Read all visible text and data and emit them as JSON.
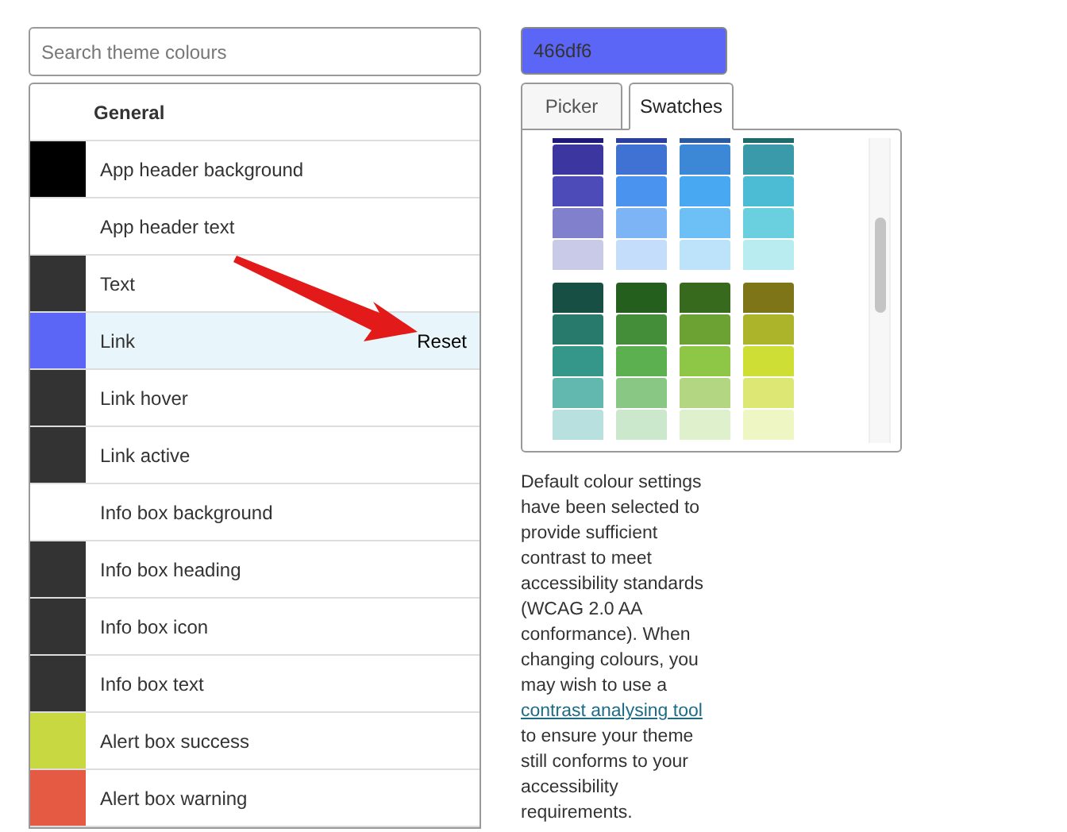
{
  "search": {
    "placeholder": "Search theme colours"
  },
  "colour_list": {
    "heading": "General",
    "items": [
      {
        "name": "App header background",
        "color": "#000000",
        "selected": false
      },
      {
        "name": "App header text",
        "color": "#ffffff",
        "selected": false
      },
      {
        "name": "Text",
        "color": "#333333",
        "selected": false
      },
      {
        "name": "Link",
        "color": "#5b66f6",
        "selected": true,
        "action": "Reset"
      },
      {
        "name": "Link hover",
        "color": "#333333",
        "selected": false
      },
      {
        "name": "Link active",
        "color": "#333333",
        "selected": false
      },
      {
        "name": "Info box background",
        "color": "#ffffff",
        "selected": false
      },
      {
        "name": "Info box heading",
        "color": "#333333",
        "selected": false
      },
      {
        "name": "Info box icon",
        "color": "#333333",
        "selected": false
      },
      {
        "name": "Info box text",
        "color": "#333333",
        "selected": false
      },
      {
        "name": "Alert box success",
        "color": "#c8d840",
        "selected": false
      },
      {
        "name": "Alert box warning",
        "color": "#e45a42",
        "selected": false
      }
    ]
  },
  "colour_field": {
    "value": "466df6",
    "color": "#5b66f6"
  },
  "tabs": [
    {
      "label": "Picker",
      "selected": false
    },
    {
      "label": "Swatches",
      "selected": true
    }
  ],
  "swatch_groups": [
    {
      "rows": [
        {
          "cut": true,
          "swatches": [
            {
              "color": "#1e1a78"
            },
            {
              "color": "#2a3f9e"
            },
            {
              "color": "#2c5aa0"
            },
            {
              "color": "#1f6a6a"
            }
          ]
        },
        {
          "cut": false,
          "swatches": [
            {
              "color": "#3c37a0"
            },
            {
              "color": "#3f72d2"
            },
            {
              "color": "#3c88d6"
            },
            {
              "color": "#3a9aaa"
            }
          ]
        },
        {
          "cut": false,
          "swatches": [
            {
              "color": "#4c4bb8"
            },
            {
              "color": "#4a93ee"
            },
            {
              "color": "#48a8f2"
            },
            {
              "color": "#4bbcd4"
            }
          ]
        },
        {
          "cut": false,
          "swatches": [
            {
              "color": "#8080cc"
            },
            {
              "color": "#7cb4f6"
            },
            {
              "color": "#6cc0f6"
            },
            {
              "color": "#6ad0e0"
            }
          ]
        },
        {
          "cut": false,
          "swatches": [
            {
              "color": "#c8cae8"
            },
            {
              "color": "#c4ddfa"
            },
            {
              "color": "#bde3fa"
            },
            {
              "color": "#b8ecf0"
            }
          ]
        }
      ]
    },
    {
      "rows": [
        {
          "cut": false,
          "swatches": [
            {
              "color": "#174f44"
            },
            {
              "color": "#255f1e"
            },
            {
              "color": "#386a1e"
            },
            {
              "color": "#7e7418"
            }
          ]
        },
        {
          "cut": false,
          "swatches": [
            {
              "color": "#277a6c"
            },
            {
              "color": "#448e3a"
            },
            {
              "color": "#6ca234"
            },
            {
              "color": "#acb42a"
            }
          ]
        },
        {
          "cut": false,
          "swatches": [
            {
              "color": "#34978a"
            },
            {
              "color": "#5cb050"
            },
            {
              "color": "#8ec646"
            },
            {
              "color": "#cede34"
            }
          ]
        },
        {
          "cut": false,
          "swatches": [
            {
              "color": "#62b8ae"
            },
            {
              "color": "#88c884"
            },
            {
              "color": "#b2d682"
            },
            {
              "color": "#dde874"
            }
          ]
        },
        {
          "cut": false,
          "swatches": [
            {
              "color": "#b8e0de"
            },
            {
              "color": "#cce8cc"
            },
            {
              "color": "#dff0cc"
            },
            {
              "color": "#eef6c4"
            }
          ]
        }
      ]
    }
  ],
  "help": {
    "before": "Default colour settings have been selected to provide sufficient contrast to meet accessibility standards (WCAG 2.0 AA conformance). When changing colours, you may wish to use a",
    "link": "contrast analysing tool",
    "after": "to ensure your theme still conforms to your accessibility requirements."
  }
}
